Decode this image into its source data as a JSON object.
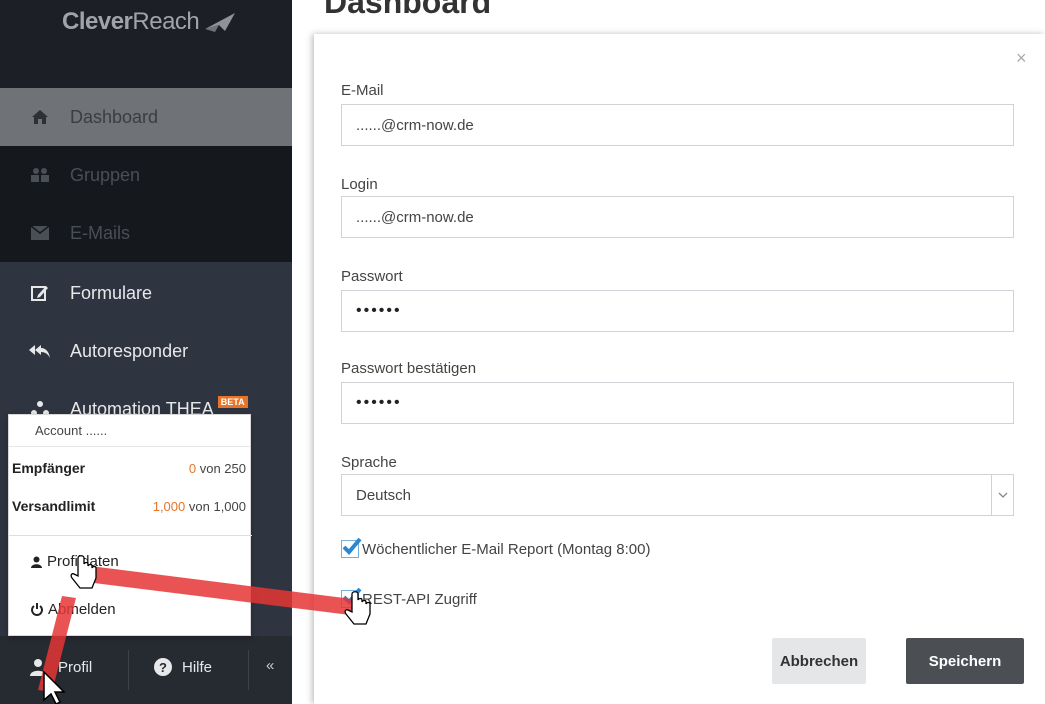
{
  "app": {
    "logo_bold": "Clever",
    "logo_light": "Reach"
  },
  "background": {
    "page_title": "Dashboard"
  },
  "sidebar": {
    "items": [
      {
        "label": "Dashboard",
        "icon": "home-icon"
      },
      {
        "label": "Gruppen",
        "icon": "users-icon"
      },
      {
        "label": "E-Mails",
        "icon": "envelope-icon"
      },
      {
        "label": "Formulare",
        "icon": "edit-icon"
      },
      {
        "label": "Autoresponder",
        "icon": "reply-all-icon"
      },
      {
        "label": "Automation THEA",
        "icon": "sitemap-icon",
        "badge": "BETA"
      }
    ],
    "bottom": {
      "profile": "Profil",
      "help": "Hilfe",
      "collapse": "«"
    }
  },
  "account_popup": {
    "header": "Account ......",
    "recipients_label": "Empfänger",
    "recipients_used": "0",
    "recipients_rest": "von 250",
    "limit_label": "Versandlimit",
    "limit_used": "1,000",
    "limit_rest": "von 1,000",
    "profile_link": "Profildaten",
    "logout_link": "Abmelden"
  },
  "modal": {
    "close": "×",
    "email_label": "E-Mail",
    "email_value": "......@crm-now.de",
    "login_label": "Login",
    "login_value": "......@crm-now.de",
    "password_label": "Passwort",
    "password_value": "••••••",
    "password_confirm_label": "Passwort bestätigen",
    "password_confirm_value": "••••••",
    "language_label": "Sprache",
    "language_value": "Deutsch",
    "weekly_report_label": "Wöchentlicher E-Mail Report (Montag 8:00)",
    "weekly_report_checked": true,
    "rest_api_label": "REST-API Zugriff",
    "rest_api_checked": true,
    "cancel_button": "Abbrechen",
    "save_button": "Speichern"
  },
  "colors": {
    "sidebar_bg": "#2f3540",
    "accent_orange": "#e8742a",
    "annotation_red": "#e53535",
    "save_button": "#4b4e53"
  }
}
